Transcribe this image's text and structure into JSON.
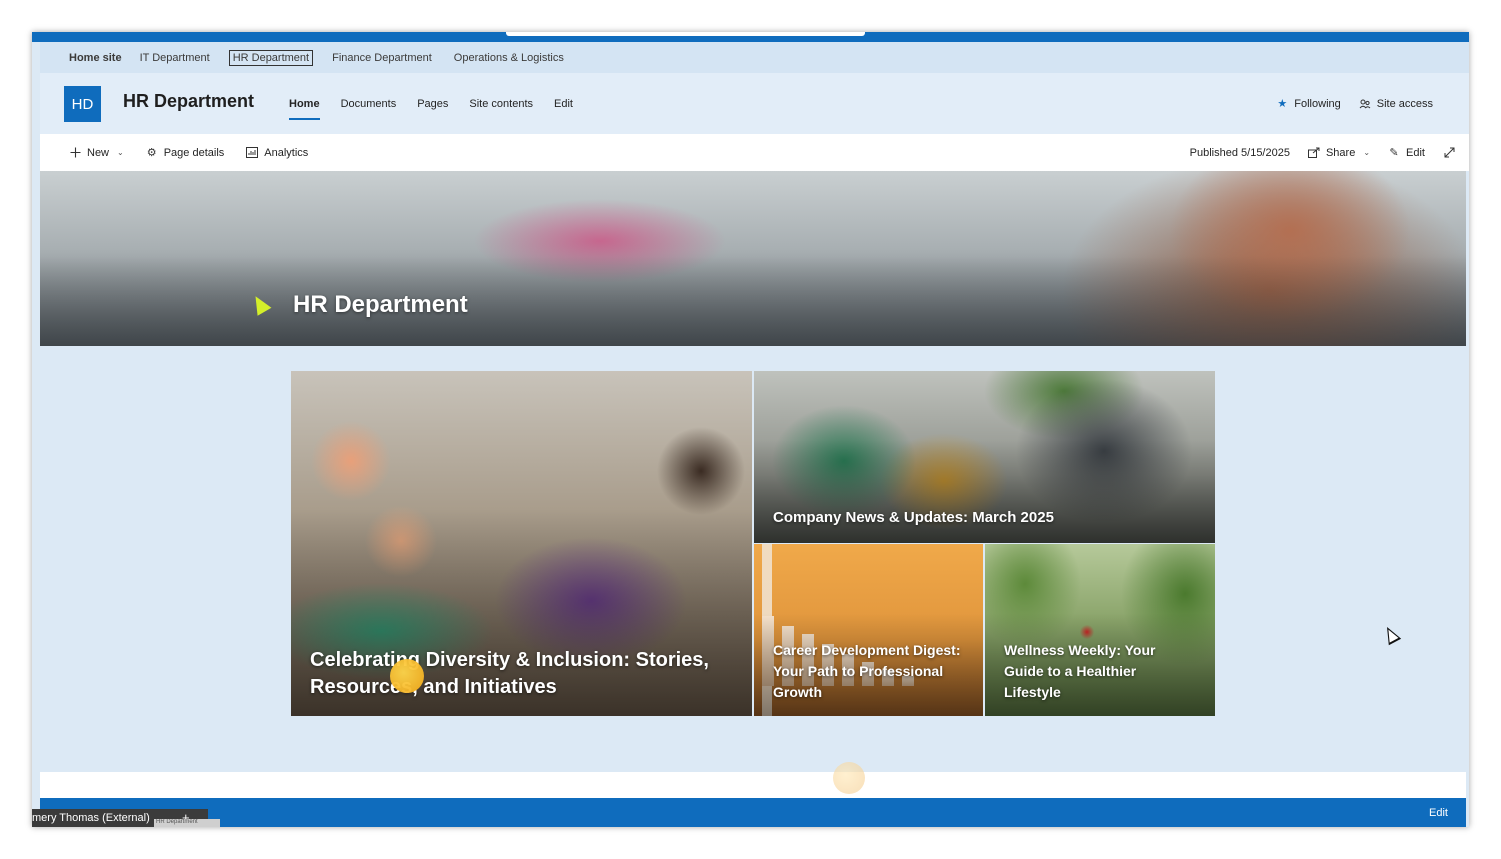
{
  "hub_nav": {
    "items": [
      {
        "label": "Home site",
        "bold": true
      },
      {
        "label": "IT Department"
      },
      {
        "label": "HR Department",
        "selected": true
      },
      {
        "label": "Finance Department"
      },
      {
        "label": "Operations & Logistics"
      }
    ]
  },
  "site_header": {
    "logo_initials": "HD",
    "title": "HR Department",
    "nav": [
      {
        "label": "Home",
        "active": true
      },
      {
        "label": "Documents"
      },
      {
        "label": "Pages"
      },
      {
        "label": "Site contents"
      },
      {
        "label": "Edit"
      }
    ],
    "following_label": "Following",
    "site_access_label": "Site access"
  },
  "command_bar": {
    "new_label": "New",
    "page_details_label": "Page details",
    "analytics_label": "Analytics",
    "published_label": "Published 5/15/2025",
    "share_label": "Share",
    "edit_label": "Edit"
  },
  "banner": {
    "title": "HR Department"
  },
  "hero": {
    "tiles": [
      {
        "title": "Celebrating Diversity & Inclusion: Stories, Resources, and Initiatives"
      },
      {
        "title": "Company News & Updates: March 2025"
      },
      {
        "title": "Career Development Digest: Your Path to Professional Growth"
      },
      {
        "title": "Wellness Weekly: Your Guide to a Healthier Lifestyle"
      }
    ]
  },
  "footer": {
    "edit_label": "Edit"
  },
  "taskbar": {
    "label": "mery Thomas (External)",
    "sub_label": "HR Department"
  },
  "colors": {
    "accent": "#0f6cbd",
    "page_background": "#dce9f5"
  },
  "icons": [
    "plus-icon",
    "gear-icon",
    "analytics-icon",
    "share-icon",
    "pencil-icon",
    "expand-icon",
    "star-icon",
    "people-icon",
    "chevron-down-icon"
  ]
}
